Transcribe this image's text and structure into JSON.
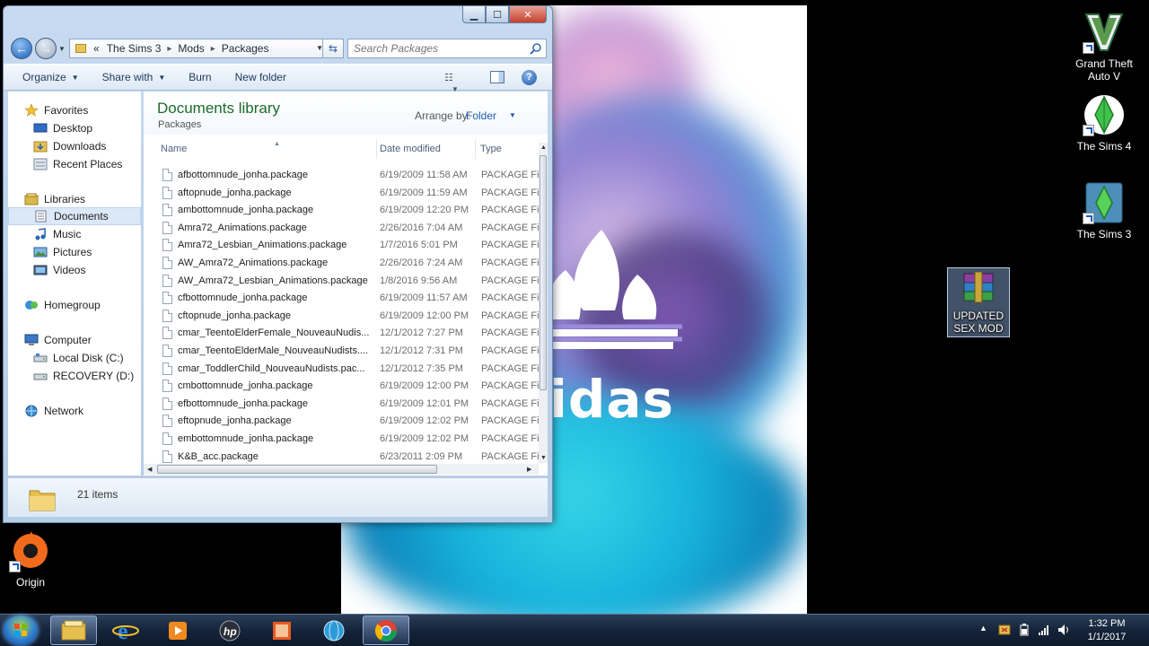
{
  "explorer": {
    "address": {
      "history_glyph": "«",
      "crumbs": [
        "The Sims 3",
        "Mods",
        "Packages"
      ],
      "separator": "▸"
    },
    "search_placeholder": "Search Packages",
    "toolbar": {
      "organize": "Organize",
      "share_with": "Share with",
      "burn": "Burn",
      "new_folder": "New folder"
    },
    "nav": {
      "favorites": "Favorites",
      "desktop": "Desktop",
      "downloads": "Downloads",
      "recent_places": "Recent Places",
      "libraries": "Libraries",
      "documents": "Documents",
      "music": "Music",
      "pictures": "Pictures",
      "videos": "Videos",
      "homegroup": "Homegroup",
      "computer": "Computer",
      "local_disk": "Local Disk (C:)",
      "recovery": "RECOVERY (D:)",
      "network": "Network"
    },
    "library": {
      "title": "Documents library",
      "subtitle": "Packages",
      "arrange_label": "Arrange by:",
      "arrange_value": "Folder"
    },
    "columns": {
      "name": "Name",
      "date": "Date modified",
      "type": "Type"
    },
    "files": [
      {
        "name": "afbottomnude_jonha.package",
        "date": "6/19/2009 11:58 AM",
        "type": "PACKAGE File"
      },
      {
        "name": "aftopnude_jonha.package",
        "date": "6/19/2009 11:59 AM",
        "type": "PACKAGE File"
      },
      {
        "name": "ambottomnude_jonha.package",
        "date": "6/19/2009 12:20 PM",
        "type": "PACKAGE File"
      },
      {
        "name": "Amra72_Animations.package",
        "date": "2/26/2016 7:04 AM",
        "type": "PACKAGE File"
      },
      {
        "name": "Amra72_Lesbian_Animations.package",
        "date": "1/7/2016 5:01 PM",
        "type": "PACKAGE File"
      },
      {
        "name": "AW_Amra72_Animations.package",
        "date": "2/26/2016 7:24 AM",
        "type": "PACKAGE File"
      },
      {
        "name": "AW_Amra72_Lesbian_Animations.package",
        "date": "1/8/2016 9:56 AM",
        "type": "PACKAGE File"
      },
      {
        "name": "cfbottomnude_jonha.package",
        "date": "6/19/2009 11:57 AM",
        "type": "PACKAGE File"
      },
      {
        "name": "cftopnude_jonha.package",
        "date": "6/19/2009 12:00 PM",
        "type": "PACKAGE File"
      },
      {
        "name": "cmar_TeentoElderFemale_NouveauNudis...",
        "date": "12/1/2012 7:27 PM",
        "type": "PACKAGE File"
      },
      {
        "name": "cmar_TeentoElderMale_NouveauNudists....",
        "date": "12/1/2012 7:31 PM",
        "type": "PACKAGE File"
      },
      {
        "name": "cmar_ToddlerChild_NouveauNudists.pac...",
        "date": "12/1/2012 7:35 PM",
        "type": "PACKAGE File"
      },
      {
        "name": "cmbottomnude_jonha.package",
        "date": "6/19/2009 12:00 PM",
        "type": "PACKAGE File"
      },
      {
        "name": "efbottomnude_jonha.package",
        "date": "6/19/2009 12:01 PM",
        "type": "PACKAGE File"
      },
      {
        "name": "eftopnude_jonha.package",
        "date": "6/19/2009 12:02 PM",
        "type": "PACKAGE File"
      },
      {
        "name": "embottomnude_jonha.package",
        "date": "6/19/2009 12:02 PM",
        "type": "PACKAGE File"
      },
      {
        "name": "K&B_acc.package",
        "date": "6/23/2011 2:09 PM",
        "type": "PACKAGE File"
      }
    ],
    "status": {
      "item_count": "21 items"
    }
  },
  "desktop": {
    "icons": {
      "gta": "Grand Theft Auto V",
      "sims4": "The Sims 4",
      "sims3": "The Sims 3",
      "mod": "UPDATED SEX MOD",
      "origin": "Origin"
    },
    "wallpaper_text": "idas"
  },
  "taskbar": {
    "time": "1:32 PM",
    "date": "1/1/2017",
    "icons": [
      "start-orb",
      "file-explorer",
      "internet-explorer",
      "media-player",
      "hp-support",
      "office",
      "globe-app",
      "chrome"
    ]
  },
  "colors": {
    "library_title": "#1d6b2a",
    "arrange_link": "#1e5dab",
    "taskbar": "#15243a",
    "selected_nav": "#dbe8f7"
  }
}
